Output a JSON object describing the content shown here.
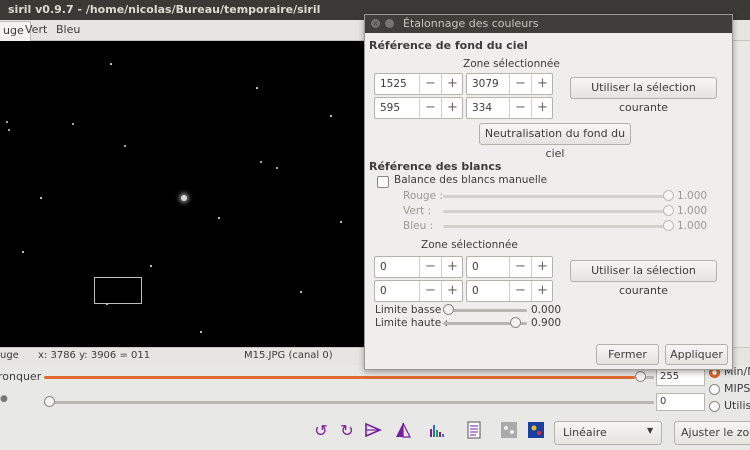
{
  "main_window": {
    "title": "siril v0.9.7 - /home/nicolas/Bureau/temporaire/siril",
    "tabs": [
      {
        "label": "uge"
      },
      {
        "label": "Vert"
      },
      {
        "label": "Bleu"
      }
    ],
    "status": {
      "channel": "uge",
      "coords": "x: 3786 y: 3906 = 011",
      "file": "M15.JPG (canal 0)"
    },
    "sliders": {
      "high_label": "ronquer",
      "high_value": "255",
      "high_fraction": 0.985,
      "low_value": "0",
      "low_fraction": 0.0
    },
    "scale_options": [
      {
        "label": "Min/M",
        "selected": true
      },
      {
        "label": "MIPS-",
        "selected": false
      },
      {
        "label": "Utilis",
        "selected": false
      }
    ],
    "toolbar": {
      "icons": [
        "rotate-left-icon",
        "rotate-right-icon",
        "mirror-x-icon",
        "mirror-y-icon",
        "histogram-icon",
        "fits-header-icon",
        "photometry-icon",
        "color-icon"
      ],
      "display_mode": "Linéaire",
      "fit_zoom_label": "Ajuster le zoom"
    }
  },
  "dialog": {
    "title": "Étalonnage des couleurs",
    "background": {
      "heading": "Référence de fond du ciel",
      "zone_label": "Zone sélectionnée",
      "x": "1525",
      "y": "3079",
      "w": "595",
      "h": "334",
      "use_selection_label": "Utiliser la sélection courante",
      "neutralize_label": "Neutralisation du fond du ciel"
    },
    "white": {
      "heading": "Référence des blancs",
      "manual_label": "Balance des blancs manuelle",
      "manual_checked": false,
      "channels": [
        {
          "label": "Rouge :",
          "value": "1.000",
          "level": 1.0
        },
        {
          "label": "Vert :",
          "value": "1.000",
          "level": 1.0
        },
        {
          "label": "Bleu :",
          "value": "1.000",
          "level": 1.0
        }
      ],
      "zone_label": "Zone sélectionnée",
      "x": "0",
      "y": "0",
      "w": "0",
      "h": "0",
      "use_selection_label": "Utiliser la sélection courante",
      "low_label": "Limite basse :",
      "low_value": "0.000",
      "low_level": 0.0,
      "high_label": "Limite haute :",
      "high_value": "0.900",
      "high_level": 0.9
    },
    "close_label": "Fermer",
    "apply_label": "Appliquer"
  }
}
